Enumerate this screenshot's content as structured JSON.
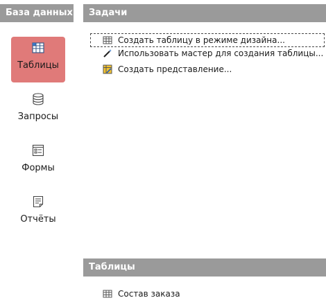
{
  "left_panel": {
    "title": "База данных"
  },
  "nav": [
    {
      "label": "Таблицы",
      "icon": "table-icon",
      "selected": true
    },
    {
      "label": "Запросы",
      "icon": "database-icon",
      "selected": false
    },
    {
      "label": "Формы",
      "icon": "form-icon",
      "selected": false
    },
    {
      "label": "Отчёты",
      "icon": "report-icon",
      "selected": false
    }
  ],
  "tasks": {
    "title": "Задачи",
    "items": [
      {
        "label": "Создать таблицу в режиме дизайна...",
        "icon": "table-design-icon"
      },
      {
        "label": "Использовать мастер для создания таблицы...",
        "icon": "wand-icon"
      },
      {
        "label": "Создать представление...",
        "icon": "view-icon"
      }
    ]
  },
  "tables": {
    "title": "Таблицы",
    "items": [
      {
        "label": "Состав заказа",
        "icon": "table-icon"
      }
    ]
  },
  "colors": {
    "header_bg": "#9a9a9a",
    "selected_bg": "#e07a79"
  }
}
